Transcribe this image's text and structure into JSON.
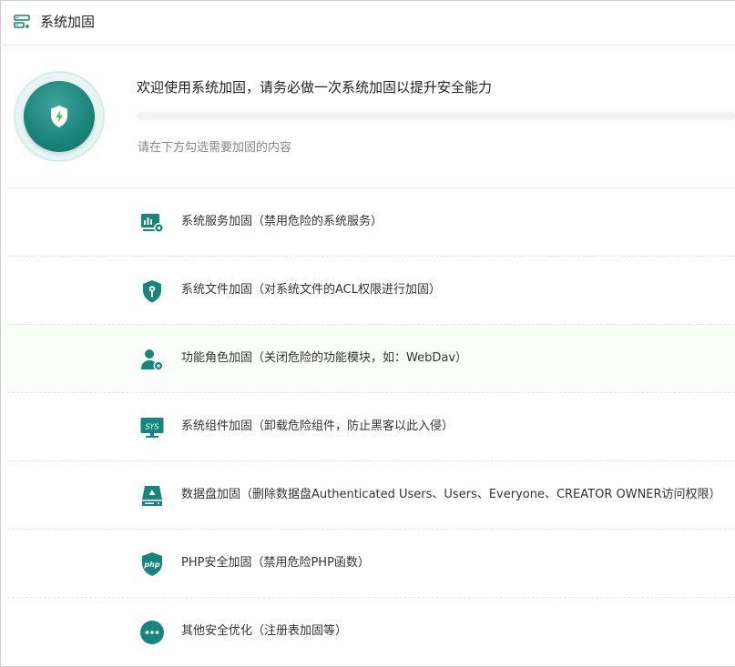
{
  "header": {
    "title": "系统加固",
    "icon": "server-lock-icon"
  },
  "hero": {
    "title": "欢迎使用系统加固，请务必做一次系统加固以提升安全能力",
    "subtitle": "请在下方勾选需要加固的内容",
    "progress": 0,
    "icon": "shield-bolt-icon"
  },
  "colors": {
    "accent": "#16867c",
    "progress_track": "#f2f2f2"
  },
  "items": [
    {
      "label": "系统服务加固（禁用危险的系统服务）",
      "icon": "service-chart-gear-icon"
    },
    {
      "label": "系统文件加固（对系统文件的ACL权限进行加固）",
      "icon": "shield-key-icon"
    },
    {
      "label": "功能角色加固（关闭危险的功能模块，如：WebDav）",
      "icon": "user-gear-icon"
    },
    {
      "label": "系统组件加固（卸载危险组件，防止黑客以此入侵）",
      "icon": "sys-monitor-icon"
    },
    {
      "label": "数据盘加固（删除数据盘Authenticated Users、Users、Everyone、CREATOR OWNER访问权限）",
      "icon": "disk-icon"
    },
    {
      "label": "PHP安全加固（禁用危险PHP函数）",
      "icon": "php-shield-icon"
    },
    {
      "label": "其他安全优化（注册表加固等）",
      "icon": "more-dots-icon"
    }
  ]
}
